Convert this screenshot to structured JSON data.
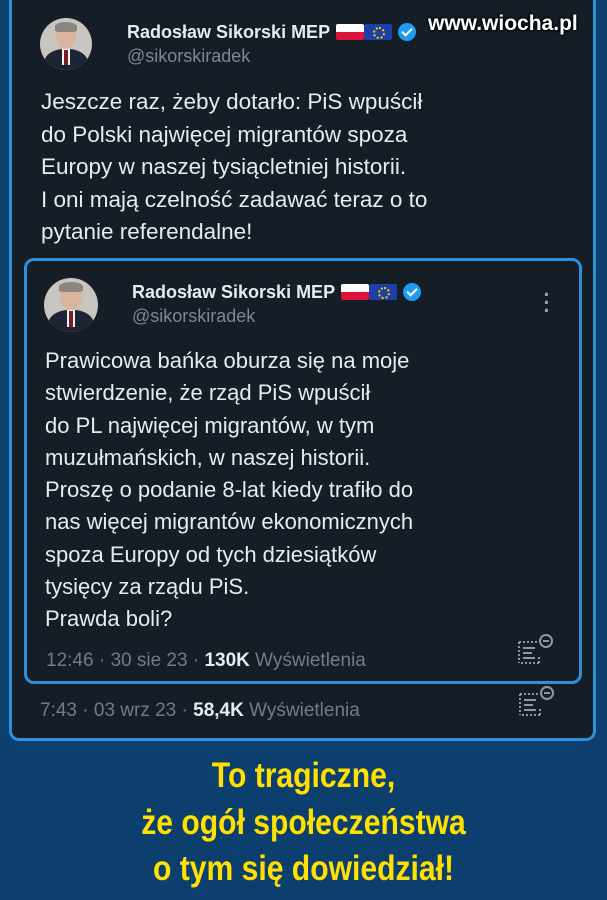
{
  "watermark": "www.wiocha.pl",
  "outer_tweet": {
    "author_name": "Radosław Sikorski MEP",
    "handle": "@sikorskiradek",
    "text": "Jeszcze raz, żeby dotarło: PiS wpuścił\ndo Polski najwięcej migrantów spoza\nEuropy w naszej tysiącletniej historii.\nI oni mają czelność zadawać teraz o to\npytanie referendalne!",
    "time": "7:43",
    "date": "03 wrz 23",
    "views_count": "58,4K",
    "views_label": "Wyświetlenia"
  },
  "quoted_tweet": {
    "author_name": "Radosław Sikorski MEP",
    "handle": "@sikorskiradek",
    "text": "Prawicowa bańka oburza się na moje\nstwierdzenie, że rząd PiS wpuścił\ndo PL najwięcej migrantów, w tym\nmuzułmańskich, w naszej historii.\nProszę o podanie 8-lat kiedy trafiło do\nnas więcej migrantów ekonomicznych\nspoza Europy od tych dziesiątków\ntysięcy za rządu PiS.\nPrawda boli?",
    "time": "12:46",
    "date": "30 sie 23",
    "views_count": "130K",
    "views_label": "Wyświetlenia"
  },
  "caption": {
    "line1": "To tragiczne,",
    "line2": "że ogół społeczeństwa",
    "line3": "o tym się dowiedział!"
  },
  "colors": {
    "background": "#0d3f6e",
    "card": "#151d27",
    "border": "#2f8fd9",
    "caption": "#ffe000",
    "verified": "#1d9bf0"
  },
  "icons": [
    "more-options-icon",
    "view-stats-icon",
    "verified-badge-icon",
    "poland-flag-icon",
    "eu-flag-icon"
  ]
}
